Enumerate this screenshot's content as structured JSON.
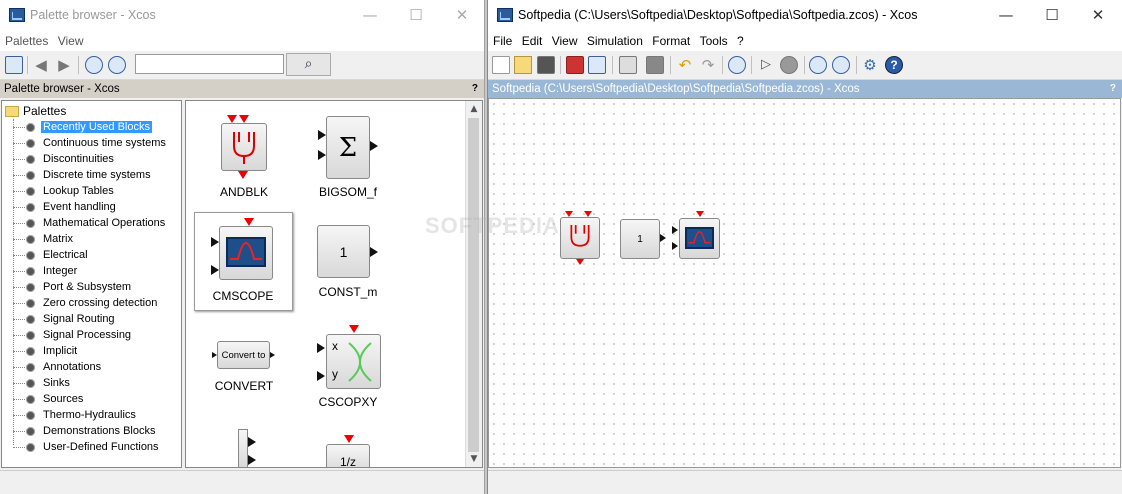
{
  "left_window": {
    "title": "Palette browser - Xcos",
    "menus": [
      "Palettes",
      "View"
    ],
    "search": {
      "value": "",
      "placeholder": ""
    },
    "panel_header": "Palette browser - Xcos",
    "help_label": "?",
    "tree": {
      "root": "Palettes",
      "items": [
        "Recently Used Blocks",
        "Continuous time systems",
        "Discontinuities",
        "Discrete time systems",
        "Lookup Tables",
        "Event handling",
        "Mathematical Operations",
        "Matrix",
        "Electrical",
        "Integer",
        "Port & Subsystem",
        "Zero crossing detection",
        "Signal Routing",
        "Signal Processing",
        "Implicit",
        "Annotations",
        "Sinks",
        "Sources",
        "Thermo-Hydraulics",
        "Demonstrations Blocks",
        "User-Defined Functions"
      ],
      "selected_index": 0
    },
    "blocks": {
      "andblk": "ANDBLK",
      "bigsom": "BIGSOM_f",
      "bigsom_symbol": "Σ",
      "cmscope": "CMSCOPE",
      "const_m": "CONST_m",
      "const_value": "1",
      "convert": "CONVERT",
      "convert_text": "Convert to",
      "cscopxy": "CSCOPXY",
      "cscopxy_x": "x",
      "cscopxy_y": "y",
      "dollar_text": "1/z"
    }
  },
  "right_window": {
    "title": "Softpedia (C:\\Users\\Softpedia\\Desktop\\Softpedia\\Softpedia.zcos) - Xcos",
    "menus": [
      "File",
      "Edit",
      "View",
      "Simulation",
      "Format",
      "Tools",
      "?"
    ],
    "panel_header": "Softpedia (C:\\Users\\Softpedia\\Desktop\\Softpedia\\Softpedia.zcos) - Xcos",
    "help_label": "?",
    "diagram": {
      "const_value": "1"
    }
  },
  "window_controls": {
    "minimize": "—",
    "maximize": "☐",
    "close": "✕"
  },
  "watermark": "SOFTPEDIA"
}
